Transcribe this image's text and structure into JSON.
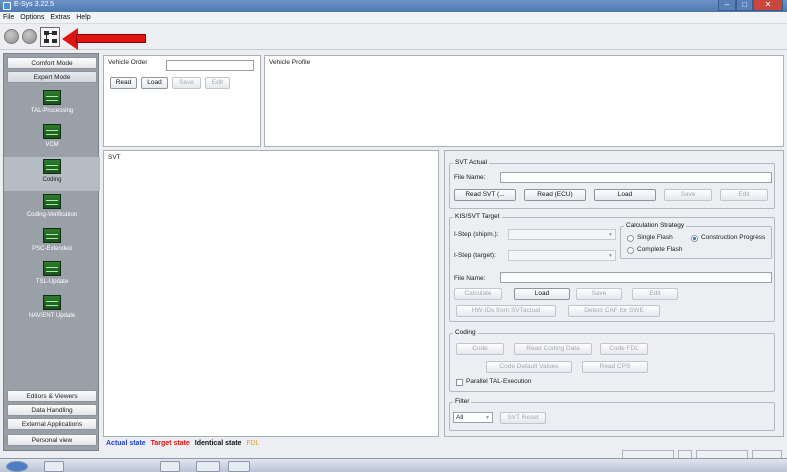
{
  "window": {
    "title": "E-Sys 3.22.5"
  },
  "menu": [
    "File",
    "Options",
    "Extras",
    "Help"
  ],
  "toolbar": {
    "icons": [
      "connect-circle-icon",
      "disconnect-circle-icon",
      "network-settings-icon"
    ]
  },
  "sidebar": {
    "top_buttons": [
      "Comfort Mode",
      "Expert Mode"
    ],
    "items": [
      "TAL-Processing",
      "VCM",
      "Coding",
      "Coding-Verification",
      "PSC-Extended",
      "TSL-Update",
      "NAV/ENT Update"
    ],
    "active_item": "Coding",
    "bottom_buttons": [
      "Editors & Viewers",
      "Data Handling",
      "External Applications",
      "Personal view"
    ]
  },
  "vehicle_order": {
    "label": "Vehicle Order",
    "value": "",
    "buttons": [
      "Read",
      "Load",
      "Save",
      "Edit"
    ]
  },
  "vehicle_profile": {
    "label": "Vehicle Profile"
  },
  "svt": {
    "label": "SVT"
  },
  "legend": {
    "actual": "Actual state",
    "actual_color": "#1f3fd8",
    "target": "Target state",
    "target_color": "#e01010",
    "identical": "Identical state",
    "identical_color": "#111111",
    "fdl": "FDL",
    "fdl_color": "#e8a020"
  },
  "svt_actual": {
    "label": "SVT Actual",
    "file_name_label": "File Name:",
    "file_name": "",
    "buttons": [
      "Read SVT (...",
      "Read (ECU)",
      "Load",
      "Save",
      "Edit"
    ]
  },
  "kis_svt_target": {
    "label": "KIS/SVT Target",
    "istep_shipm_label": "I-Step (shipm.):",
    "istep_target_label": "I-Step (target):",
    "calc_strategy": {
      "label": "Calculation Strategy",
      "options": [
        "Single Flash",
        "Complete Flash",
        "Construction Progress"
      ],
      "selected": "Construction Progress"
    },
    "file_name_label": "File Name:",
    "file_name": "",
    "buttons": [
      "Calculate",
      "Load",
      "Save",
      "Edit"
    ],
    "buttons2": [
      "HW-IDs from SVTactual",
      "Detect CAF for SWE"
    ]
  },
  "coding": {
    "label": "Coding",
    "buttons": [
      "Code",
      "Read Coding Data",
      "Code FDL"
    ],
    "buttons2": [
      "Code Default Values",
      "Read CPS"
    ],
    "checkbox": "Parallel TAL-Execution"
  },
  "filter": {
    "label": "Filter",
    "select_value": "All",
    "button": "SVT Reset"
  }
}
